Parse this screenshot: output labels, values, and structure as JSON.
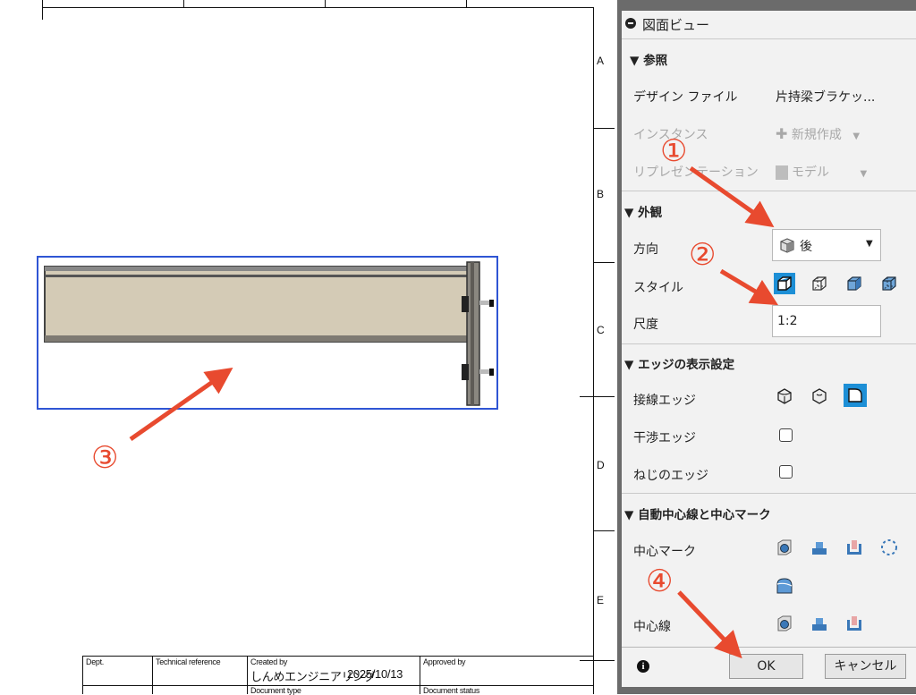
{
  "sheet": {
    "zones": [
      "A",
      "B",
      "C",
      "D",
      "E"
    ]
  },
  "title_block": {
    "dept": "Dept.",
    "technical_reference": "Technical reference",
    "created_by_label": "Created by",
    "created_by_value": "しんめエンジニアリング",
    "date": "2025/10/13",
    "approved_by": "Approved by",
    "document_type": "Document type",
    "document_status": "Document status"
  },
  "panel": {
    "title": "図面ビュー",
    "sections": {
      "reference": {
        "heading": "参照",
        "design_file_label": "デザイン ファイル",
        "design_file_value": "片持梁ブラケッ...",
        "instance_label": "インスタンス",
        "instance_value": "新規作成",
        "representation_label": "リプレゼンテーション",
        "representation_value": "モデル"
      },
      "appearance": {
        "heading": "外観",
        "orientation_label": "方向",
        "orientation_value": "後",
        "style_label": "スタイル",
        "scale_label": "尺度",
        "scale_value": "1:2"
      },
      "edges": {
        "heading": "エッジの表示設定",
        "tangent_label": "接線エッジ",
        "interference_label": "干渉エッジ",
        "thread_label": "ねじのエッジ"
      },
      "centerlines": {
        "heading": "自動中心線と中心マーク",
        "center_mark_label": "中心マーク",
        "centerline_label": "中心線"
      }
    },
    "footer": {
      "ok": "OK",
      "cancel": "キャンセル"
    }
  },
  "callouts": [
    "①",
    "②",
    "③",
    "④"
  ],
  "colors": {
    "accent_blue": "#1d8fd6",
    "selection_blue": "#2f55d4",
    "annotation_red": "#e84a2f"
  }
}
